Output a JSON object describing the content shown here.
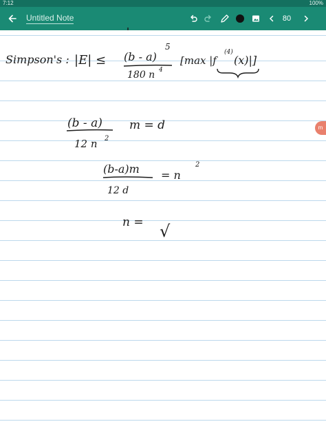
{
  "status": {
    "time": "7:12",
    "battery": "100%"
  },
  "app": {
    "title": "Untitled Note",
    "zoom": "80",
    "colors": {
      "statusbar": "#14705f",
      "appbar": "#1a8a74",
      "rule_lines": "#bcd8ec",
      "ink": "#1c1c1c",
      "edge_tab": "#e9806c"
    },
    "icons": [
      "arrow-left-icon",
      "undo-icon",
      "redo-icon",
      "pen-icon",
      "color-dot-icon",
      "image-icon",
      "chevron-left-icon",
      "chevron-right-icon"
    ]
  },
  "note": {
    "line1": {
      "label": "Simpson's :",
      "lhs": "|E| ≤",
      "numerator": "(b - a)",
      "exponent": "5",
      "denominator": "180 n",
      "denominator_exp": "4",
      "bracket_expr": "[max |f",
      "derivative_order": "(4)",
      "bracket_tail": "(x)|]"
    },
    "line2": {
      "numerator": "(b - a)",
      "denominator": "12 n",
      "denominator_exp": "2",
      "rhs": "m = d"
    },
    "line3": {
      "numerator": "(b-a)m",
      "denominator": "12 d",
      "rhs": "= n",
      "rhs_exp": "2"
    },
    "line4": {
      "lhs": "n =",
      "rhs": "√"
    }
  },
  "edge_tab": {
    "label": "m"
  }
}
